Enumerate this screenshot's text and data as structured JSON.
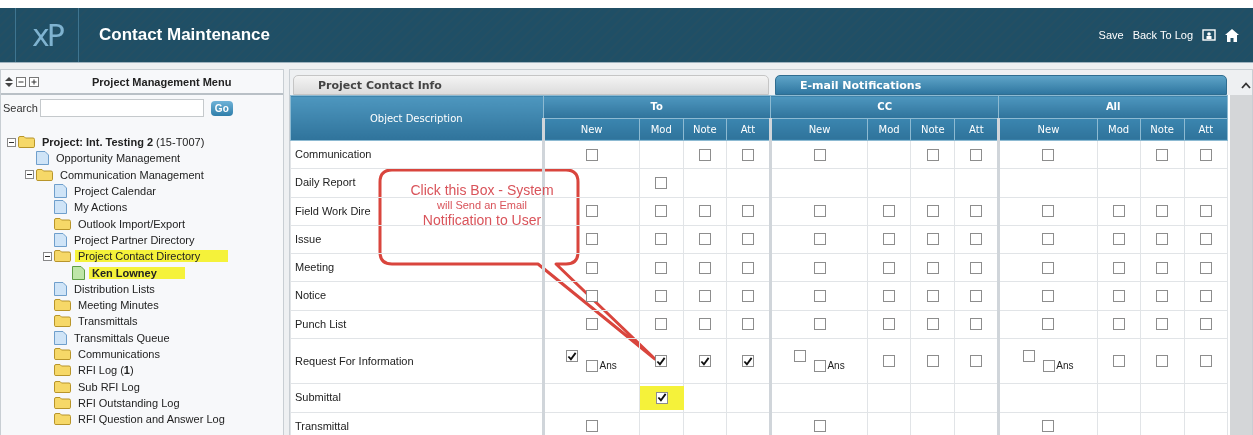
{
  "header": {
    "logo": "xP",
    "title": "Contact Maintenance",
    "actions": [
      "Save",
      "Back To Log"
    ]
  },
  "menu": {
    "title": "Project Management Menu",
    "search_label": "Search",
    "go": "Go",
    "tree": [
      {
        "label": "**Project: Int. Testing 2** (15-T007)",
        "kind": "folder",
        "expanded": true,
        "highlighted": false,
        "children": [
          {
            "label": "Opportunity Management",
            "kind": "page",
            "highlighted": false
          },
          {
            "label": "Communication Management",
            "kind": "folder",
            "expanded": true,
            "highlighted": false,
            "children": [
              {
                "label": "Project Calendar",
                "kind": "page",
                "highlighted": false
              },
              {
                "label": "My Actions",
                "kind": "page",
                "highlighted": false
              },
              {
                "label": "Outlook Import/Export",
                "kind": "folder",
                "expanded": false,
                "highlighted": false
              },
              {
                "label": "Project Partner Directory",
                "kind": "page",
                "highlighted": false
              },
              {
                "label": "Project Contact Directory",
                "kind": "folder",
                "expanded": true,
                "highlighted": true,
                "children": [
                  {
                    "label": "**Ken Lowney**",
                    "kind": "contact",
                    "highlighted": true
                  }
                ]
              },
              {
                "label": "Distribution Lists",
                "kind": "page",
                "highlighted": false
              },
              {
                "label": "Meeting Minutes",
                "kind": "folder",
                "expanded": false,
                "highlighted": false
              },
              {
                "label": "Transmittals",
                "kind": "folder",
                "expanded": false,
                "highlighted": false
              },
              {
                "label": "Transmittals Queue",
                "kind": "page",
                "highlighted": false
              },
              {
                "label": "Communications",
                "kind": "folder",
                "expanded": false,
                "highlighted": false
              },
              {
                "label": "RFI Log (**1**)",
                "kind": "folder",
                "expanded": false,
                "highlighted": false
              },
              {
                "label": "Sub RFI Log",
                "kind": "folder",
                "expanded": false,
                "highlighted": false
              },
              {
                "label": "RFI Outstanding Log",
                "kind": "folder",
                "expanded": false,
                "highlighted": false
              },
              {
                "label": "RFI Question and Answer Log",
                "kind": "folder",
                "expanded": false,
                "highlighted": false
              }
            ]
          }
        ]
      }
    ]
  },
  "tabs": [
    {
      "label": "Project Contact Info",
      "selected": false
    },
    {
      "label": "E-mail Notifications",
      "selected": true
    }
  ],
  "table": {
    "first_column": "Object Description",
    "groups": [
      {
        "label": "To",
        "subcolumns": [
          "New",
          "Mod",
          "Note",
          "Att"
        ]
      },
      {
        "label": "CC",
        "subcolumns": [
          "New",
          "Mod",
          "Note",
          "Att"
        ]
      },
      {
        "label": "All",
        "subcolumns": [
          "New",
          "Mod",
          "Note",
          "Att"
        ]
      }
    ],
    "rows": [
      {
        "name": "Communication",
        "cells": [
          {
            "kind": "box",
            "checked": false
          },
          {
            "kind": "empty"
          },
          {
            "kind": "box",
            "checked": false
          },
          {
            "kind": "box",
            "checked": false
          },
          {
            "kind": "box",
            "checked": false
          },
          {
            "kind": "empty"
          },
          {
            "kind": "box",
            "checked": false
          },
          {
            "kind": "box",
            "checked": false
          },
          {
            "kind": "box",
            "checked": false
          },
          {
            "kind": "empty"
          },
          {
            "kind": "box",
            "checked": false
          },
          {
            "kind": "box",
            "checked": false
          }
        ]
      },
      {
        "name": "Daily Report",
        "cells": [
          {
            "kind": "empty"
          },
          {
            "kind": "box",
            "checked": false
          },
          {
            "kind": "empty"
          },
          {
            "kind": "empty"
          },
          {
            "kind": "empty"
          },
          {
            "kind": "empty"
          },
          {
            "kind": "empty"
          },
          {
            "kind": "empty"
          },
          {
            "kind": "empty"
          },
          {
            "kind": "empty"
          },
          {
            "kind": "empty"
          },
          {
            "kind": "empty"
          }
        ]
      },
      {
        "name": "Field Work Dire",
        "cells": [
          {
            "kind": "box",
            "checked": false
          },
          {
            "kind": "box",
            "checked": false
          },
          {
            "kind": "box",
            "checked": false
          },
          {
            "kind": "box",
            "checked": false
          },
          {
            "kind": "box",
            "checked": false
          },
          {
            "kind": "box",
            "checked": false
          },
          {
            "kind": "box",
            "checked": false
          },
          {
            "kind": "box",
            "checked": false
          },
          {
            "kind": "box",
            "checked": false
          },
          {
            "kind": "box",
            "checked": false
          },
          {
            "kind": "box",
            "checked": false
          },
          {
            "kind": "box",
            "checked": false
          }
        ]
      },
      {
        "name": "Issue",
        "cells": [
          {
            "kind": "box",
            "checked": false
          },
          {
            "kind": "box",
            "checked": false
          },
          {
            "kind": "box",
            "checked": false
          },
          {
            "kind": "box",
            "checked": false
          },
          {
            "kind": "box",
            "checked": false
          },
          {
            "kind": "box",
            "checked": false
          },
          {
            "kind": "box",
            "checked": false
          },
          {
            "kind": "box",
            "checked": false
          },
          {
            "kind": "box",
            "checked": false
          },
          {
            "kind": "box",
            "checked": false
          },
          {
            "kind": "box",
            "checked": false
          },
          {
            "kind": "box",
            "checked": false
          }
        ]
      },
      {
        "name": "Meeting",
        "cells": [
          {
            "kind": "box",
            "checked": false
          },
          {
            "kind": "box",
            "checked": false
          },
          {
            "kind": "box",
            "checked": false
          },
          {
            "kind": "box",
            "checked": false
          },
          {
            "kind": "box",
            "checked": false
          },
          {
            "kind": "box",
            "checked": false
          },
          {
            "kind": "box",
            "checked": false
          },
          {
            "kind": "box",
            "checked": false
          },
          {
            "kind": "box",
            "checked": false
          },
          {
            "kind": "box",
            "checked": false
          },
          {
            "kind": "box",
            "checked": false
          },
          {
            "kind": "box",
            "checked": false
          }
        ]
      },
      {
        "name": "Notice",
        "cells": [
          {
            "kind": "box",
            "checked": false
          },
          {
            "kind": "box",
            "checked": false
          },
          {
            "kind": "box",
            "checked": false
          },
          {
            "kind": "box",
            "checked": false
          },
          {
            "kind": "box",
            "checked": false
          },
          {
            "kind": "box",
            "checked": false
          },
          {
            "kind": "box",
            "checked": false
          },
          {
            "kind": "box",
            "checked": false
          },
          {
            "kind": "box",
            "checked": false
          },
          {
            "kind": "box",
            "checked": false
          },
          {
            "kind": "box",
            "checked": false
          },
          {
            "kind": "box",
            "checked": false
          }
        ]
      },
      {
        "name": "Punch List",
        "cells": [
          {
            "kind": "box",
            "checked": false
          },
          {
            "kind": "box",
            "checked": false
          },
          {
            "kind": "box",
            "checked": false
          },
          {
            "kind": "box",
            "checked": false
          },
          {
            "kind": "box",
            "checked": false
          },
          {
            "kind": "box",
            "checked": false
          },
          {
            "kind": "box",
            "checked": false
          },
          {
            "kind": "box",
            "checked": false
          },
          {
            "kind": "box",
            "checked": false
          },
          {
            "kind": "box",
            "checked": false
          },
          {
            "kind": "box",
            "checked": false
          },
          {
            "kind": "box",
            "checked": false
          }
        ]
      },
      {
        "name": "Request For Information",
        "cells": [
          {
            "kind": "box_ans",
            "checked": true,
            "ans_checked": false,
            "ans_label": "Ans"
          },
          {
            "kind": "box",
            "checked": true
          },
          {
            "kind": "box",
            "checked": true
          },
          {
            "kind": "box",
            "checked": true
          },
          {
            "kind": "box_ans",
            "checked": false,
            "ans_checked": false,
            "ans_label": "Ans"
          },
          {
            "kind": "box",
            "checked": false
          },
          {
            "kind": "box",
            "checked": false
          },
          {
            "kind": "box",
            "checked": false
          },
          {
            "kind": "box_ans",
            "checked": false,
            "ans_checked": false,
            "ans_label": "Ans"
          },
          {
            "kind": "box",
            "checked": false
          },
          {
            "kind": "box",
            "checked": false
          },
          {
            "kind": "box",
            "checked": false
          }
        ]
      },
      {
        "name": "Submittal",
        "cells": [
          {
            "kind": "empty"
          },
          {
            "kind": "box",
            "checked": true,
            "highlighted": true
          },
          {
            "kind": "empty"
          },
          {
            "kind": "empty"
          },
          {
            "kind": "empty"
          },
          {
            "kind": "empty"
          },
          {
            "kind": "empty"
          },
          {
            "kind": "empty"
          },
          {
            "kind": "empty"
          },
          {
            "kind": "empty"
          },
          {
            "kind": "empty"
          },
          {
            "kind": "empty"
          }
        ]
      },
      {
        "name": "Transmittal",
        "cells": [
          {
            "kind": "box",
            "checked": false
          },
          {
            "kind": "empty"
          },
          {
            "kind": "empty"
          },
          {
            "kind": "empty"
          },
          {
            "kind": "box",
            "checked": false
          },
          {
            "kind": "empty"
          },
          {
            "kind": "empty"
          },
          {
            "kind": "empty"
          },
          {
            "kind": "box",
            "checked": false
          },
          {
            "kind": "empty"
          },
          {
            "kind": "empty"
          },
          {
            "kind": "empty"
          }
        ]
      }
    ]
  },
  "callout": {
    "lines": [
      {
        "text": "Click this Box - System",
        "kind": "large"
      },
      {
        "text": "will Send an Email",
        "kind": "small"
      },
      {
        "text": "Notification to User",
        "kind": "large"
      }
    ]
  }
}
